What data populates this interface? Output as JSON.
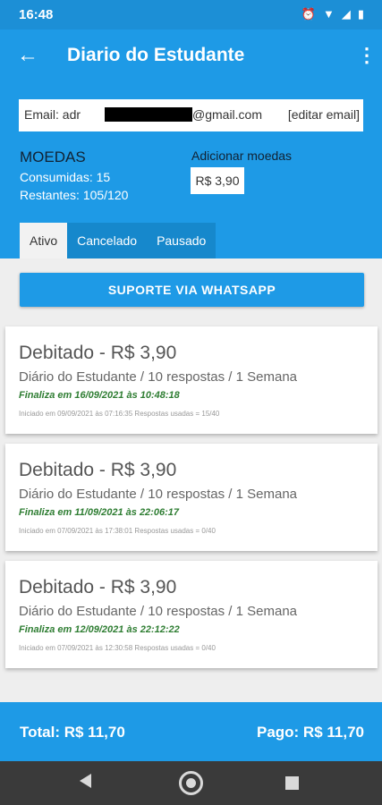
{
  "status_bar": {
    "time": "16:48",
    "icons": [
      "alarm-icon",
      "wifi-icon",
      "signal-icon",
      "battery-icon"
    ]
  },
  "app_bar": {
    "title": "Diario do Estudante",
    "back_icon": "arrow-left-icon",
    "menu_icon": "more-vert-icon"
  },
  "account": {
    "email_label": "Email: adr",
    "email_domain": "@gmail.com",
    "edit_email": "[editar email]"
  },
  "coins": {
    "title": "MOEDAS",
    "used": "Consumidas: 15",
    "remaining": "Restantes: 105/120",
    "add_label": "Adicionar moedas",
    "add_button": "R$ 3,90"
  },
  "tabs": [
    {
      "label": "Ativo",
      "active": true
    },
    {
      "label": "Cancelado",
      "active": false
    },
    {
      "label": "Pausado",
      "active": false
    }
  ],
  "support_button": "SUPORTE VIA WHATSAPP",
  "cards": [
    {
      "title": "Debitado - R$ 3,90",
      "description": "Diário do Estudante / 10 respostas / 1 Semana",
      "ends": "Finaliza em 16/09/2021 às 10:48:18",
      "meta": "Iniciado em 09/09/2021 às 07:16:35 Respostas usadas = 15/40"
    },
    {
      "title": "Debitado - R$ 3,90",
      "description": "Diário do Estudante / 10 respostas / 1 Semana",
      "ends": "Finaliza em 11/09/2021 às 22:06:17",
      "meta": "Iniciado em 07/09/2021 às 17:38:01 Respostas usadas = 0/40"
    },
    {
      "title": "Debitado - R$ 3,90",
      "description": "Diário do Estudante / 10 respostas / 1 Semana",
      "ends": "Finaliza em 12/09/2021 às 22:12:22",
      "meta": "Iniciado em 07/09/2021 às 12:30:58 Respostas usadas = 0/40"
    }
  ],
  "footer": {
    "total": "Total: R$ 11,70",
    "paid": "Pago: R$ 11,70"
  },
  "nav": {
    "back": "nav-back-icon",
    "home": "nav-home-icon",
    "recent": "nav-recent-icon"
  },
  "colors": {
    "primary": "#1e9ae6",
    "status_bar": "#1c8fd6",
    "success": "#2e7d32",
    "nav_bar": "#3a3a3a"
  }
}
